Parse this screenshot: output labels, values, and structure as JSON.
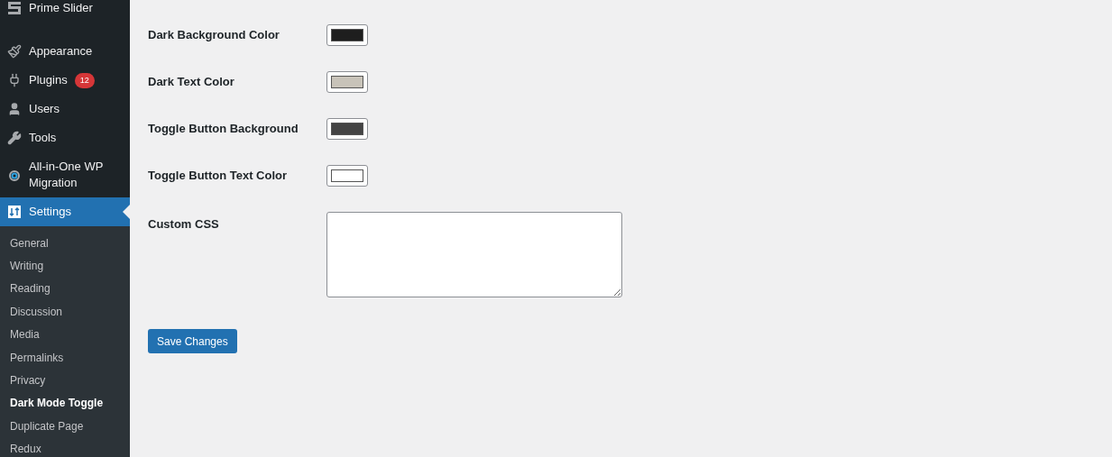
{
  "sidebar": {
    "menu": [
      {
        "kind": "logo",
        "label": "Prime Slider",
        "selected": false
      },
      {
        "kind": "brush",
        "label": "Appearance",
        "selected": false
      },
      {
        "kind": "plug",
        "label": "Plugins",
        "badge": "12",
        "selected": false
      },
      {
        "kind": "user",
        "label": "Users",
        "selected": false
      },
      {
        "kind": "wrench",
        "label": "Tools",
        "selected": false
      },
      {
        "kind": "migration",
        "label": "All-in-One WP Migration",
        "selected": false
      },
      {
        "kind": "settings",
        "label": "Settings",
        "selected": true
      }
    ],
    "submenu": [
      {
        "label": "General",
        "selected": false
      },
      {
        "label": "Writing",
        "selected": false
      },
      {
        "label": "Reading",
        "selected": false
      },
      {
        "label": "Discussion",
        "selected": false
      },
      {
        "label": "Media",
        "selected": false
      },
      {
        "label": "Permalinks",
        "selected": false
      },
      {
        "label": "Privacy",
        "selected": false
      },
      {
        "label": "Dark Mode Toggle",
        "selected": true
      },
      {
        "label": "Duplicate Page",
        "selected": false
      },
      {
        "label": "Redux",
        "selected": false
      }
    ]
  },
  "settings": [
    {
      "label": "Dark Background Color",
      "color": "#1e1e1e"
    },
    {
      "label": "Dark Text Color",
      "color": "#c8c3b9"
    },
    {
      "label": "Toggle Button Background",
      "color": "#444444"
    },
    {
      "label": "Toggle Button Text Color",
      "color": "#ffffff"
    }
  ],
  "custom_css": {
    "label": "Custom CSS"
  },
  "save_button": "Save Changes"
}
